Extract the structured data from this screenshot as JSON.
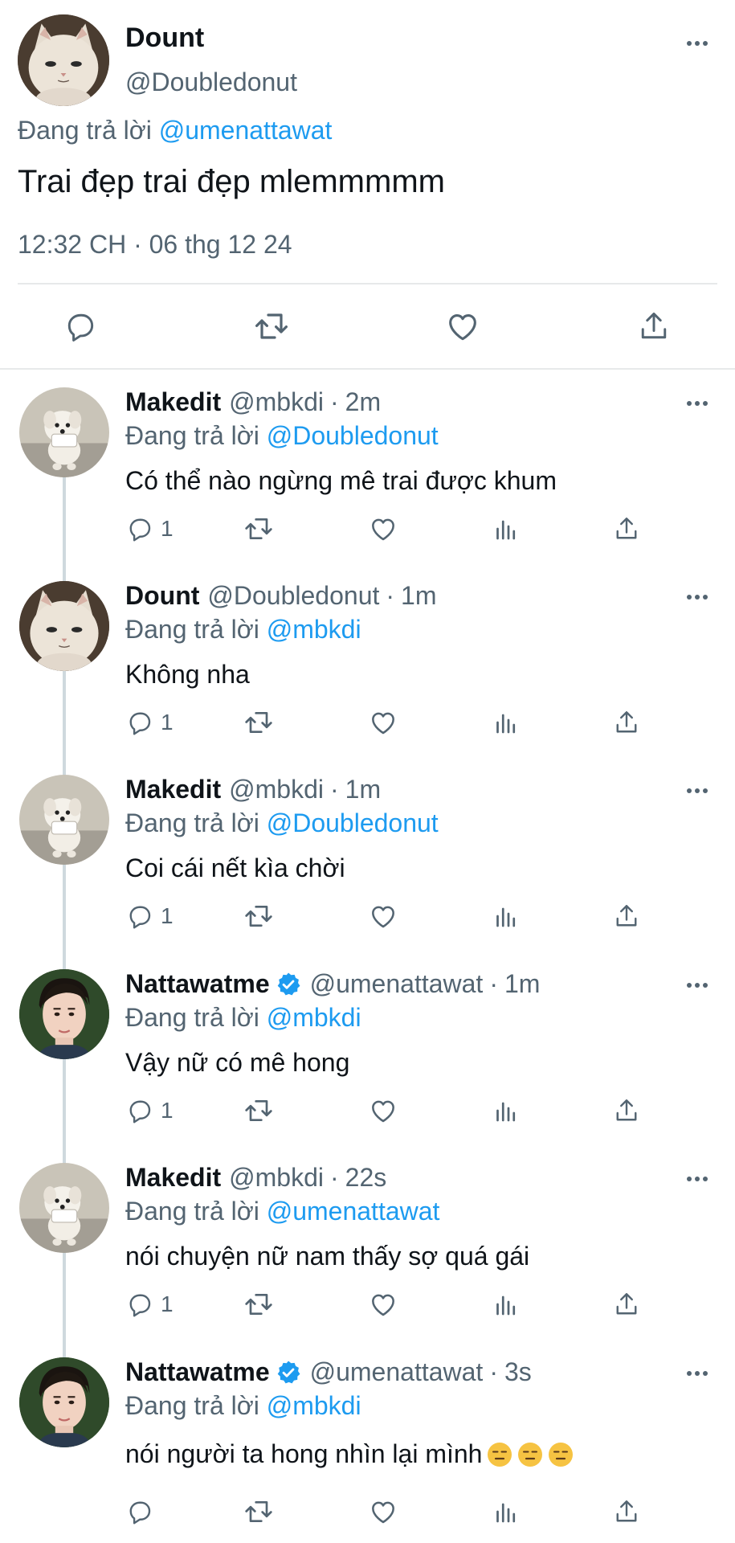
{
  "main_tweet": {
    "name": "Dount",
    "handle": "@Doubledonut",
    "replying_label": "Đang trả lời",
    "replying_to": "@umenattawat",
    "text": "Trai đẹp trai đẹp mlemmmmm",
    "timestamp": "12:32 CH · 06 thg 12 24"
  },
  "replies": [
    {
      "name": "Makedit",
      "handle": "@mbkdi",
      "time": "2m",
      "replying_label": "Đang trả lời",
      "replying_to": "@Doubledonut",
      "text": "Có thể nào ngừng mê trai được khum",
      "reply_count": "1",
      "avatar": "white-puppy",
      "verified": false
    },
    {
      "name": "Dount",
      "handle": "@Doubledonut",
      "time": "1m",
      "replying_label": "Đang trả lời",
      "replying_to": "@mbkdi",
      "text": "Không nha",
      "reply_count": "1",
      "avatar": "white-cat",
      "verified": false
    },
    {
      "name": "Makedit",
      "handle": "@mbkdi",
      "time": "1m",
      "replying_label": "Đang trả lời",
      "replying_to": "@Doubledonut",
      "text": "Coi cái nết kìa chời",
      "reply_count": "1",
      "avatar": "white-puppy",
      "verified": false
    },
    {
      "name": "Nattawatme",
      "handle": "@umenattawat",
      "time": "1m",
      "replying_label": "Đang trả lời",
      "replying_to": "@mbkdi",
      "text": "Vậy nữ có mê hong",
      "reply_count": "1",
      "avatar": "man-portrait",
      "verified": true
    },
    {
      "name": "Makedit",
      "handle": "@mbkdi",
      "time": "22s",
      "replying_label": "Đang trả lời",
      "replying_to": "@umenattawat",
      "text": "nói chuyện nữ nam thấy sợ quá gái",
      "reply_count": "1",
      "avatar": "white-puppy",
      "verified": false
    },
    {
      "name": "Nattawatme",
      "handle": "@umenattawat",
      "time": "3s",
      "replying_label": "Đang trả lời",
      "replying_to": "@mbkdi",
      "text": "nói người ta hong nhìn lại mình",
      "reply_count": "",
      "avatar": "man-portrait",
      "verified": true,
      "emojis": [
        "expressionless-face",
        "expressionless-face",
        "expressionless-face"
      ]
    }
  ],
  "colors": {
    "accent": "#1d9bf0",
    "secondary_text": "#536471",
    "divider": "#e7e9ea",
    "thread_line": "#cfd9de"
  },
  "icons": [
    "more-icon",
    "reply-icon",
    "retweet-icon",
    "like-icon",
    "views-icon",
    "share-icon",
    "verified-badge-icon"
  ]
}
